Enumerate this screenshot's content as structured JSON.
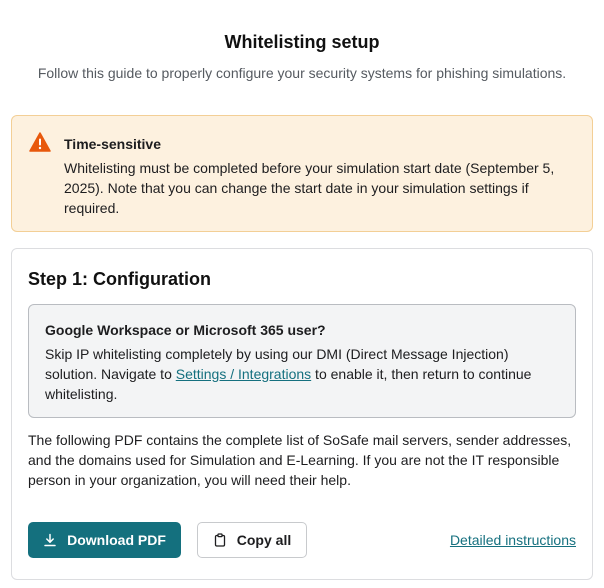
{
  "header": {
    "title": "Whitelisting setup",
    "subtitle": "Follow this guide to properly configure your security systems for phishing simulations."
  },
  "alert": {
    "icon": "warning-triangle-icon",
    "color": "#e8590c",
    "title": "Time-sensitive",
    "body": "Whitelisting must be completed before your simulation start date (September 5, 2025). Note that you can change the start date in your simulation settings if required."
  },
  "step": {
    "title": "Step 1: Configuration",
    "info": {
      "title": "Google Workspace or Microsoft 365 user?",
      "body_before": "Skip IP whitelisting completely by using our DMI (Direct Message Injection) solution. Navigate to ",
      "link": "Settings / Integrations",
      "body_after": " to enable it, then return to continue whitelisting."
    },
    "description": "The following PDF contains the complete list of SoSafe mail servers, sender addresses, and the domains used for Simulation and E-Learning. If you are not the IT responsible person in your organization, you will need their help.",
    "actions": {
      "download_label": "Download PDF",
      "download_icon": "download-icon",
      "copy_label": "Copy all",
      "copy_icon": "clipboard-icon",
      "details_label": "Detailed instructions"
    }
  },
  "colors": {
    "accent": "#14707e",
    "link": "#15707f",
    "alert_bg": "#fdf1df",
    "alert_border": "#f3cf96"
  }
}
